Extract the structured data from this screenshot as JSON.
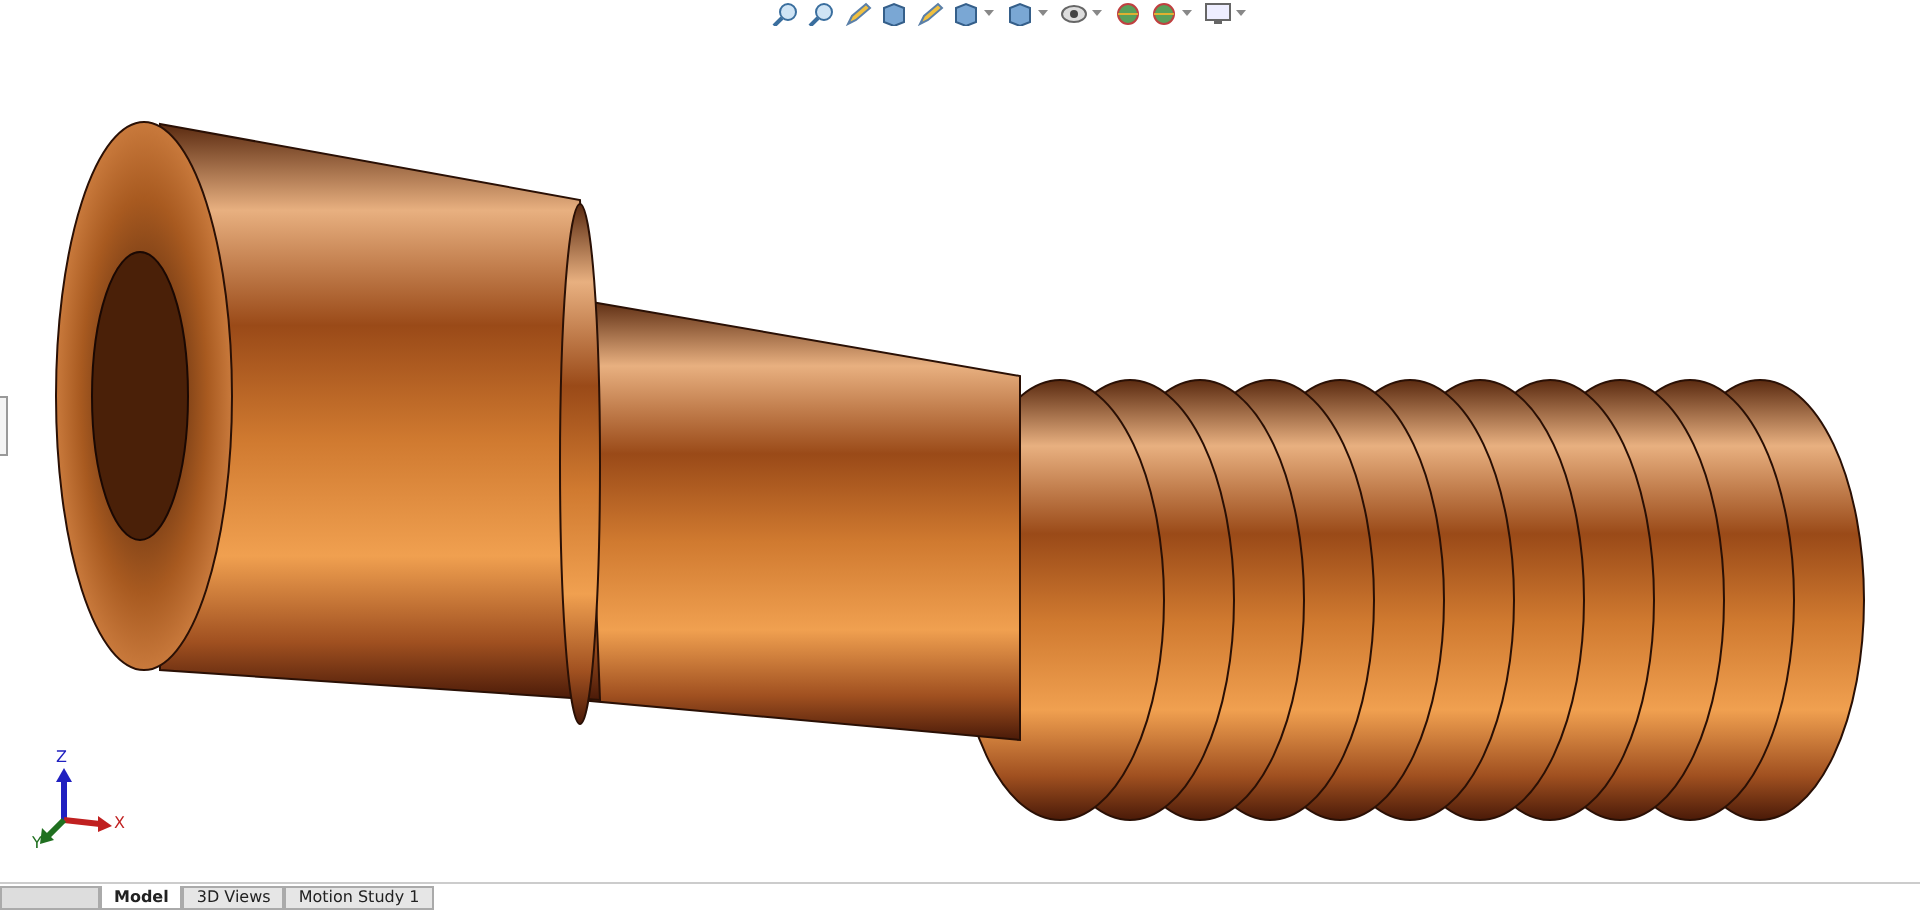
{
  "toolbar": {
    "items": [
      {
        "kind": "zoom"
      },
      {
        "kind": "zoom"
      },
      {
        "kind": "pencil"
      },
      {
        "kind": "cube"
      },
      {
        "kind": "pencil"
      },
      {
        "kind": "cube"
      },
      {
        "kind": "caret"
      },
      {
        "kind": "cube"
      },
      {
        "kind": "caret"
      },
      {
        "kind": "eye"
      },
      {
        "kind": "caret"
      },
      {
        "kind": "globe"
      },
      {
        "kind": "globe"
      },
      {
        "kind": "caret"
      },
      {
        "kind": "monitor"
      },
      {
        "kind": "caret"
      }
    ]
  },
  "triad": {
    "axes": [
      {
        "label": "Z",
        "color": "#2020c0"
      },
      {
        "label": "X",
        "color": "#c02020"
      },
      {
        "label": "Y",
        "color": "#207020"
      }
    ]
  },
  "tabs": [
    {
      "label": "Model",
      "selected": true
    },
    {
      "label": "3D Views",
      "selected": false
    },
    {
      "label": "Motion Study 1",
      "selected": false
    }
  ]
}
